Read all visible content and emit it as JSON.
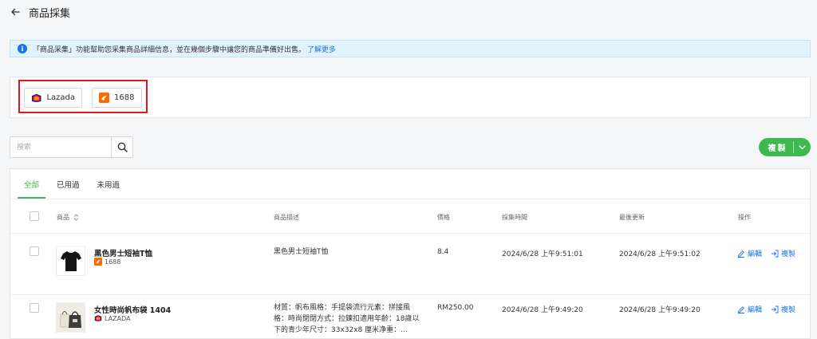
{
  "header": {
    "title": "商品採集"
  },
  "banner": {
    "text": "「商品采集」功能幫助您采集商品詳細信息，並在幾個步驟中讓您的商品準備好出售。",
    "link": "了解更多"
  },
  "sources": [
    {
      "label": "Lazada"
    },
    {
      "label": "1688"
    }
  ],
  "search": {
    "placeholder": "搜索"
  },
  "copy_button": {
    "label": "複製"
  },
  "tabs": [
    {
      "label": "全部",
      "active": true
    },
    {
      "label": "已用過",
      "active": false
    },
    {
      "label": "未用過",
      "active": false
    }
  ],
  "columns": {
    "product": "商品",
    "description": "商品描述",
    "price": "價格",
    "collected": "採集時間",
    "updated": "最後更新",
    "actions": "操作"
  },
  "actions": {
    "edit": "編輯",
    "copy": "複製"
  },
  "rows": [
    {
      "name": "黑色男士短袖T恤",
      "source": "1688",
      "description": "黑色男士短袖T恤",
      "price": "8.4",
      "collected": "2024/6/28 上午9:51:01",
      "updated": "2024/6/28 上午9:51:02"
    },
    {
      "name": "女性時尚帆布袋 1404",
      "source": "LAZADA",
      "description": "材質：帆布風格：手提袋流行元素：拼接風格：時尚閉閉方式：拉鍊扣適用年齡：18歲以下的青少年尺寸：33x32x8 厘米净重：…",
      "price": "RM250.00",
      "collected": "2024/6/28 上午9:49:20",
      "updated": "2024/6/28 上午9:49:20"
    }
  ],
  "colors": {
    "accent": "#3dba4e",
    "link": "#1a73e8",
    "highlight": "#e3161c"
  }
}
